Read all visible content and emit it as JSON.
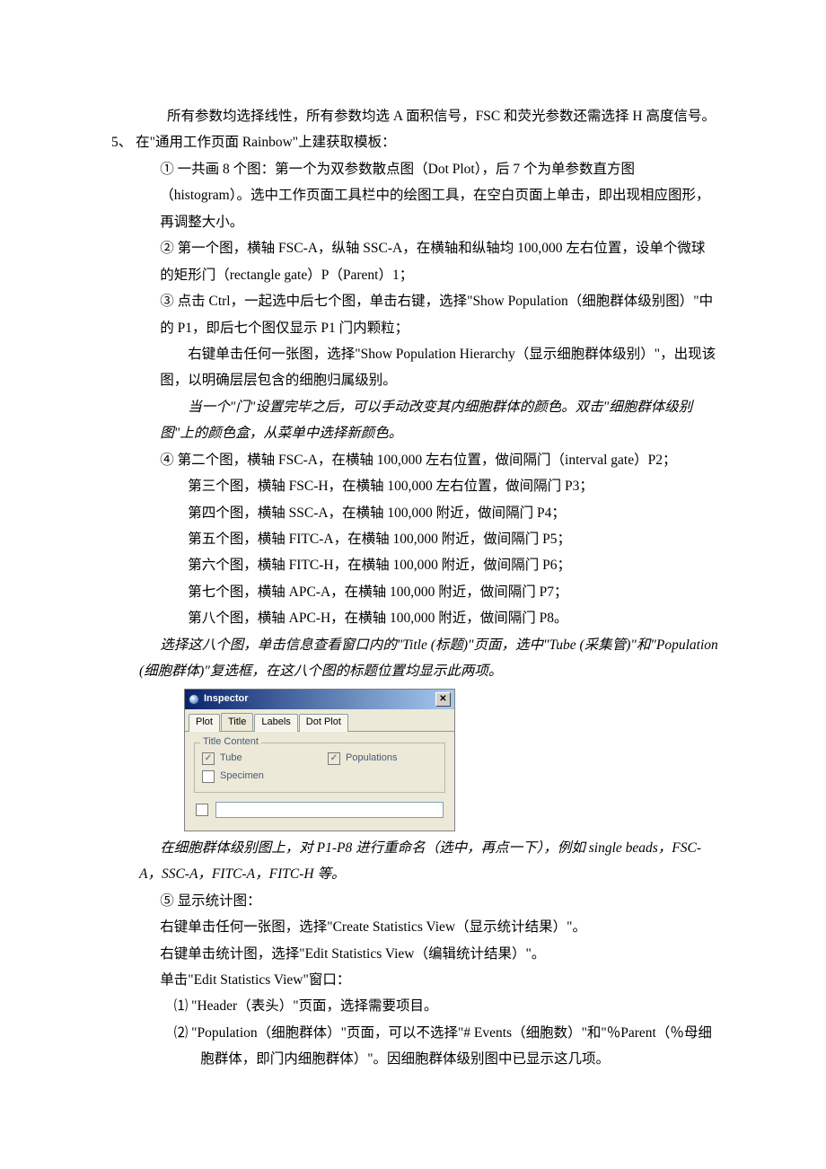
{
  "p_top": "所有参数均选择线性，所有参数均选 A 面积信号，FSC 和荧光参数还需选择 H 高度信号。",
  "item5_lead": "5、 在\"通用工作页面 Rainbow\"上建获取模板：",
  "s1a": "①  一共画 8 个图：第一个为双参数散点图（Dot Plot），后 7 个为单参数直方图（histogram）。选中工作页面工具栏中的绘图工具，在空白页面上单击，即出现相应图形，再调整大小。",
  "s2a": "②  第一个图，横轴 FSC-A，纵轴 SSC-A，在横轴和纵轴均 100,000 左右位置，设单个微球的矩形门（rectangle gate）P（Parent）1；",
  "s3a": "③  点击 Ctrl，一起选中后七个图，单击右键，选择\"Show Population（细胞群体级别图）\"中的 P1，即后七个图仅显示 P1 门内颗粒；",
  "s3b": "右键单击任何一张图，选择\"Show Population Hierarchy（显示细胞群体级别）\"，出现该图，以明确层层包含的细胞归属级别。",
  "s3c_italic": "当一个\"门\"设置完毕之后，可以手动改变其内细胞群体的颜色。双击\"细胞群体级别图\"上的颜色盒，从菜单中选择新颜色。",
  "s4a": "④  第二个图，横轴 FSC-A，在横轴 100,000 左右位置，做间隔门（interval gate）P2；",
  "s4_l3": "第三个图，横轴 FSC-H，在横轴 100,000 左右位置，做间隔门 P3；",
  "s4_l4": "第四个图，横轴 SSC-A，在横轴 100,000 附近，做间隔门 P4；",
  "s4_l5": "第五个图，横轴 FITC-A，在横轴 100,000 附近，做间隔门 P5；",
  "s4_l6": "第六个图，横轴 FITC-H，在横轴 100,000 附近，做间隔门 P6；",
  "s4_l7": "第七个图，横轴 APC-A，在横轴 100,000 附近，做间隔门 P7；",
  "s4_l8": "第八个图，横轴 APC-H，在横轴 100,000 附近，做间隔门 P8。",
  "s4_note1": "选择这八个图，单击信息查看窗口内的\"Title (标题)\"页面，选中\"Tube (采集管)\"和\"Population (细胞群体)\"复选框，在这八个图的标题位置均显示此两项。",
  "inspector": {
    "title": "Inspector",
    "tabs": {
      "plot": "Plot",
      "title": "Title",
      "labels": "Labels",
      "dotplot": "Dot Plot"
    },
    "legend": "Title Content",
    "tube": "Tube",
    "populations": "Populations",
    "specimen": "Specimen"
  },
  "after_inspector": "在细胞群体级别图上，对 P1-P8 进行重命名（选中，再点一下），例如 single beads，FSC-A，SSC-A，FITC-A，FITC-H 等。",
  "s5a": "⑤  显示统计图：",
  "s5b": "右键单击任何一张图，选择\"Create Statistics View（显示统计结果）\"。",
  "s5c": "右键单击统计图，选择\"Edit Statistics View（编辑统计结果）\"。",
  "s5d": "单击\"Edit Statistics View\"窗口：",
  "s5_li1": "⑴ \"Header（表头）\"页面，选择需要项目。",
  "s5_li2": "⑵ \"Population（细胞群体）\"页面，可以不选择\"# Events（细胞数）\"和\"％Parent（％母细胞群体，即门内细胞群体）\"。因细胞群体级别图中已显示这几项。"
}
